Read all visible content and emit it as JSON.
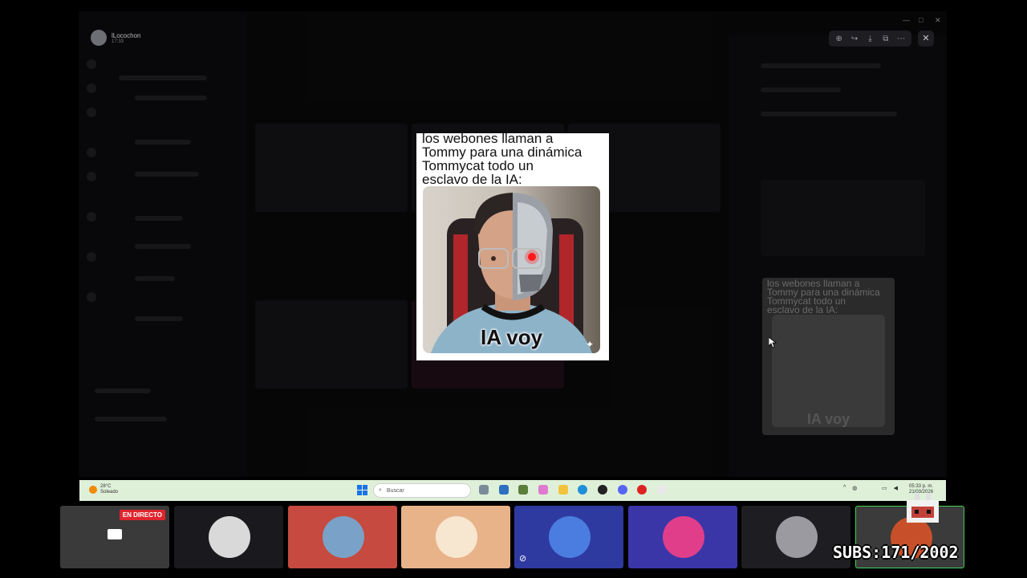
{
  "viewer": {
    "user_name": "lLocochon",
    "user_time": "17:33",
    "toolbar_icons": [
      "zoom-in-icon",
      "share-icon",
      "download-icon",
      "open-external-icon",
      "more-icon"
    ],
    "close_label": "✕"
  },
  "meme": {
    "caption": "los webones llaman a\nTommy para una dinámica\nTommycat todo un\nesclavo de la IA:",
    "image_label": "IA voy",
    "sparkle": "✦"
  },
  "taskbar": {
    "temperature": "28°C",
    "weather": "Soleado",
    "search_placeholder": "Buscar",
    "time": "05:33 p. m.",
    "date": "21/03/2026"
  },
  "stream": {
    "live_badge": "EN DIRECTO",
    "subs_text": "SUBS:171/2002"
  },
  "colors": {
    "live_red": "#e0242e",
    "taskbar_bg": "#dff0d9",
    "cam_tiles": [
      "#3a3a3a",
      "#1a1a1e",
      "#c64a3f",
      "#e9b38a",
      "#2f3aa0",
      "#3a36a8",
      "#1e1e22",
      "#3b3b3b"
    ]
  }
}
